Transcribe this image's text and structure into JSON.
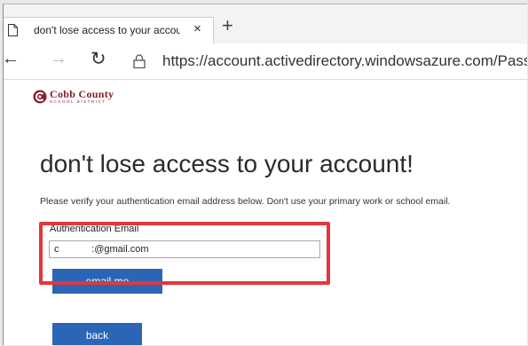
{
  "browser": {
    "tab_title": "don't lose access to your accoun",
    "tab_close": "×",
    "new_tab": "+",
    "back": "←",
    "forward": "→",
    "refresh": "↻",
    "url": "https://account.activedirectory.windowsazure.com/Passwor"
  },
  "logo": {
    "name": "Cobb County",
    "subtitle": "SCHOOL DISTRICT",
    "color": "#8a1c2b"
  },
  "page": {
    "heading": "don't lose access to your account!",
    "description": "Please verify your authentication email address below. Don't use your primary work or school email.",
    "field_label": "Authentication Email",
    "email_value": "c            :@gmail.com",
    "email_button": "email me",
    "back_button": "back"
  },
  "colors": {
    "button": "#2b66b6",
    "highlight": "#e3363d"
  },
  "icons": [
    "page-icon",
    "lock-icon",
    "back-arrow-icon",
    "forward-arrow-icon",
    "refresh-icon",
    "close-icon",
    "plus-icon"
  ]
}
